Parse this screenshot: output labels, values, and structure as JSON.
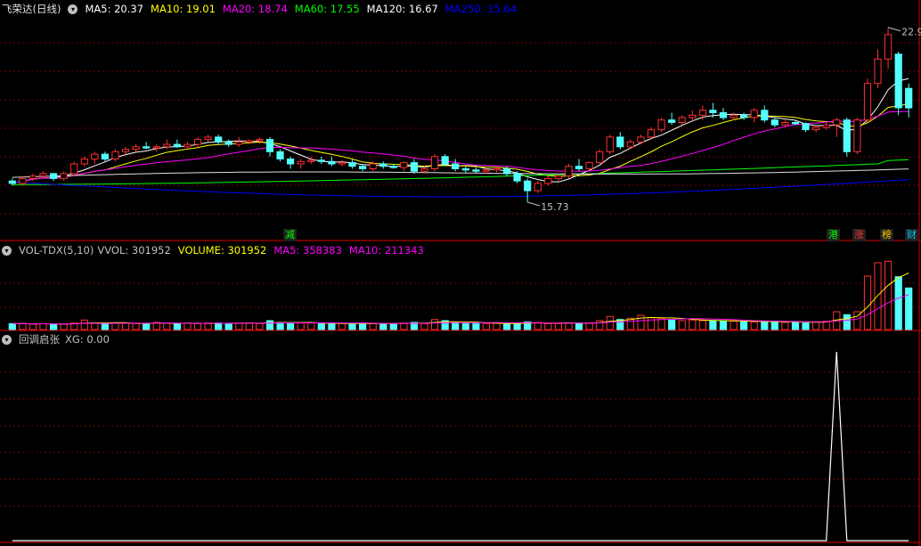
{
  "main_panel": {
    "stock_title": "飞荣达(日线)",
    "ma_legend": [
      {
        "label": "MA5: 20.37",
        "color": "#ffffff"
      },
      {
        "label": "MA10: 19.01",
        "color": "#ffff00"
      },
      {
        "label": "MA20: 18.74",
        "color": "#ff00ff"
      },
      {
        "label": "MA60: 17.55",
        "color": "#00ff00"
      },
      {
        "label": "MA120: 16.67",
        "color": "#ffffff"
      },
      {
        "label": "MA250: 15.64",
        "color": "#0000ff"
      }
    ],
    "high_marker": "22.9",
    "low_marker": "15.73",
    "badges": [
      {
        "label": "减",
        "color": "#00ff00"
      },
      {
        "label": "港",
        "color": "#00ff00"
      },
      {
        "label": "涨",
        "color": "#ff3030"
      },
      {
        "label": "榜",
        "color": "#ffcc00"
      },
      {
        "label": "财",
        "color": "#00ccff"
      }
    ]
  },
  "volume_panel": {
    "title": "VOL-TDX(5,10)",
    "legend": [
      {
        "label": "VVOL: 301952",
        "color": "#c0c0c0"
      },
      {
        "label": "VOLUME: 301952",
        "color": "#ffff00"
      },
      {
        "label": "MA5: 358383",
        "color": "#ff00ff"
      },
      {
        "label": "MA10: 211343",
        "color": "#ff00ff"
      }
    ]
  },
  "indicator_panel": {
    "title": "回调启张",
    "legend": [
      {
        "label": "XG: 0.00",
        "color": "#c0c0c0"
      }
    ]
  },
  "colors": {
    "up": "#ff3030",
    "down": "#54ffff",
    "grid": "#7a0000",
    "axis": "#b00000"
  },
  "chart_data": {
    "type": "candlestick",
    "candles": [
      [
        16.6,
        16.7,
        16.4,
        16.5
      ],
      [
        16.5,
        16.8,
        16.4,
        16.7
      ],
      [
        16.7,
        16.9,
        16.6,
        16.8
      ],
      [
        16.8,
        17.0,
        16.7,
        16.9
      ],
      [
        16.9,
        16.9,
        16.6,
        16.7
      ],
      [
        16.7,
        17.0,
        16.6,
        16.9
      ],
      [
        16.9,
        17.4,
        16.8,
        17.3
      ],
      [
        17.3,
        17.6,
        17.2,
        17.5
      ],
      [
        17.5,
        17.8,
        17.3,
        17.7
      ],
      [
        17.7,
        17.8,
        17.4,
        17.5
      ],
      [
        17.5,
        17.9,
        17.4,
        17.8
      ],
      [
        17.8,
        18.0,
        17.7,
        17.9
      ],
      [
        17.9,
        18.1,
        17.8,
        18.0
      ],
      [
        18.0,
        18.2,
        17.9,
        17.95
      ],
      [
        17.95,
        18.1,
        17.8,
        18.0
      ],
      [
        18.0,
        18.3,
        17.9,
        18.1
      ],
      [
        18.1,
        18.3,
        17.95,
        18.0
      ],
      [
        18.0,
        18.2,
        17.9,
        18.1
      ],
      [
        18.1,
        18.4,
        18.0,
        18.3
      ],
      [
        18.3,
        18.5,
        18.2,
        18.4
      ],
      [
        18.4,
        18.5,
        18.1,
        18.2
      ],
      [
        18.2,
        18.3,
        18.0,
        18.1
      ],
      [
        18.1,
        18.4,
        18.0,
        18.2
      ],
      [
        18.2,
        18.3,
        18.1,
        18.25
      ],
      [
        18.25,
        18.4,
        18.1,
        18.3
      ],
      [
        18.3,
        18.4,
        17.6,
        17.8
      ],
      [
        17.8,
        17.9,
        17.4,
        17.5
      ],
      [
        17.5,
        17.6,
        17.1,
        17.3
      ],
      [
        17.3,
        17.5,
        17.1,
        17.4
      ],
      [
        17.4,
        17.6,
        17.3,
        17.45
      ],
      [
        17.45,
        17.6,
        17.3,
        17.4
      ],
      [
        17.4,
        17.6,
        17.2,
        17.3
      ],
      [
        17.3,
        17.45,
        17.2,
        17.35
      ],
      [
        17.35,
        17.5,
        17.1,
        17.2
      ],
      [
        17.2,
        17.3,
        17.0,
        17.1
      ],
      [
        17.1,
        17.4,
        17.0,
        17.3
      ],
      [
        17.3,
        17.4,
        17.1,
        17.2
      ],
      [
        17.2,
        17.3,
        17.1,
        17.15
      ],
      [
        17.15,
        17.4,
        17.0,
        17.35
      ],
      [
        17.35,
        17.5,
        16.9,
        17.0
      ],
      [
        17.0,
        17.2,
        16.9,
        17.1
      ],
      [
        17.1,
        17.7,
        17.0,
        17.6
      ],
      [
        17.6,
        17.7,
        17.2,
        17.3
      ],
      [
        17.3,
        17.5,
        17.0,
        17.1
      ],
      [
        17.1,
        17.2,
        16.95,
        17.05
      ],
      [
        17.05,
        17.15,
        16.9,
        17.0
      ],
      [
        17.0,
        17.1,
        16.9,
        17.05
      ],
      [
        17.05,
        17.2,
        16.95,
        17.1
      ],
      [
        17.1,
        17.2,
        16.8,
        16.9
      ],
      [
        16.9,
        17.0,
        16.5,
        16.6
      ],
      [
        16.6,
        16.7,
        15.73,
        16.2
      ],
      [
        16.2,
        16.6,
        16.1,
        16.5
      ],
      [
        16.5,
        16.8,
        16.4,
        16.7
      ],
      [
        16.7,
        16.9,
        16.6,
        16.8
      ],
      [
        16.8,
        17.3,
        16.7,
        17.2
      ],
      [
        17.2,
        17.5,
        17.0,
        17.1
      ],
      [
        17.1,
        17.4,
        17.0,
        17.35
      ],
      [
        17.35,
        17.9,
        17.3,
        17.8
      ],
      [
        17.8,
        18.5,
        17.7,
        18.4
      ],
      [
        18.4,
        18.6,
        17.9,
        18.0
      ],
      [
        18.0,
        18.3,
        17.9,
        18.2
      ],
      [
        18.2,
        18.5,
        18.1,
        18.4
      ],
      [
        18.4,
        18.8,
        18.3,
        18.7
      ],
      [
        18.7,
        19.2,
        18.6,
        19.1
      ],
      [
        19.1,
        19.4,
        18.9,
        19.0
      ],
      [
        19.0,
        19.3,
        18.9,
        19.2
      ],
      [
        19.2,
        19.5,
        19.0,
        19.3
      ],
      [
        19.3,
        19.7,
        19.1,
        19.5
      ],
      [
        19.5,
        19.8,
        19.2,
        19.4
      ],
      [
        19.4,
        19.6,
        19.1,
        19.2
      ],
      [
        19.2,
        19.4,
        19.1,
        19.3
      ],
      [
        19.3,
        19.4,
        19.1,
        19.2
      ],
      [
        19.2,
        19.6,
        19.0,
        19.5
      ],
      [
        19.5,
        19.7,
        19.0,
        19.1
      ],
      [
        19.1,
        19.2,
        18.8,
        18.9
      ],
      [
        18.9,
        19.1,
        18.8,
        19.0
      ],
      [
        19.0,
        19.1,
        18.9,
        18.95
      ],
      [
        18.95,
        19.0,
        18.6,
        18.7
      ],
      [
        18.7,
        18.9,
        18.6,
        18.8
      ],
      [
        18.8,
        19.0,
        18.7,
        18.9
      ],
      [
        18.9,
        19.2,
        18.4,
        19.1
      ],
      [
        19.1,
        19.2,
        17.6,
        17.8
      ],
      [
        17.8,
        19.2,
        17.7,
        19.1
      ],
      [
        19.1,
        20.8,
        19.0,
        20.6
      ],
      [
        20.6,
        22.0,
        20.4,
        21.6
      ],
      [
        21.6,
        22.9,
        21.2,
        22.6
      ],
      [
        21.8,
        21.9,
        19.3,
        19.6
      ],
      [
        20.4,
        20.6,
        19.2,
        19.6
      ]
    ],
    "volume": [
      20,
      20,
      18,
      20,
      18,
      18,
      22,
      32,
      22,
      18,
      22,
      22,
      20,
      20,
      24,
      22,
      18,
      22,
      20,
      22,
      22,
      20,
      22,
      22,
      20,
      30,
      24,
      22,
      22,
      22,
      20,
      20,
      20,
      20,
      22,
      20,
      20,
      20,
      22,
      24,
      20,
      34,
      30,
      24,
      20,
      20,
      20,
      22,
      20,
      20,
      26,
      24,
      20,
      20,
      22,
      22,
      22,
      30,
      44,
      34,
      38,
      48,
      40,
      38,
      32,
      30,
      32,
      30,
      30,
      28,
      28,
      26,
      26,
      28,
      26,
      24,
      26,
      22,
      26,
      28,
      60,
      50,
      60,
      180,
      225,
      230,
      178,
      140
    ],
    "xg_signal_index": 80,
    "xg_signal_value": 1,
    "price_ylim": [
      15.73,
      22.9
    ]
  }
}
